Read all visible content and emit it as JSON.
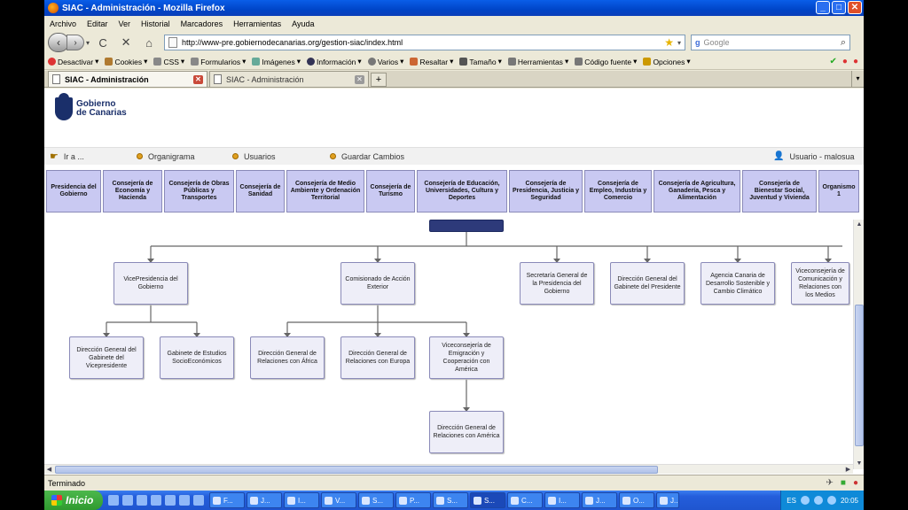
{
  "window": {
    "title": "SIAC - Administración - Mozilla Firefox",
    "minimize": "_",
    "maximize": "□",
    "close": "✕"
  },
  "menu": [
    "Archivo",
    "Editar",
    "Ver",
    "Historial",
    "Marcadores",
    "Herramientas",
    "Ayuda"
  ],
  "nav": {
    "url": "http://www-pre.gobiernodecanarias.org/gestion-siac/index.html",
    "search_placeholder": "Google",
    "back_icon": "‹",
    "forward_icon": "›",
    "reload_icon": "C",
    "stop_icon": "✕",
    "home_icon": "⌂"
  },
  "devbar": [
    "Desactivar",
    "Cookies",
    "CSS",
    "Formularios",
    "Imágenes",
    "Información",
    "Varios",
    "Resaltar",
    "Tamaño",
    "Herramientas",
    "Código fuente",
    "Opciones"
  ],
  "tabs": [
    {
      "label": "SIAC - Administración",
      "active": true
    },
    {
      "label": "SIAC - Administración",
      "active": false
    }
  ],
  "logo": {
    "line1": "Gobierno",
    "line2": "de Canarias"
  },
  "actions": {
    "ira": "Ir a ...",
    "organigrama": "Organigrama",
    "usuarios": "Usuarios",
    "guardar": "Guardar Cambios",
    "usuario": "Usuario - malosua"
  },
  "departments": [
    "Presidencia del Gobierno",
    "Consejería de Economía y Hacienda",
    "Consejería de Obras Públicas y Transportes",
    "Consejería de Sanidad",
    "Consejería de Medio Ambiente y Ordenación Territorial",
    "Consejería de Turismo",
    "Consejería de Educación, Universidades, Cultura y Deportes",
    "Consejería de Presidencia, Justicia y Seguridad",
    "Consejería de Empleo, Industria y Comercio",
    "Consejería de Agricultura, Ganadería, Pesca y Alimentación",
    "Consejería de Bienestar Social, Juventud y Vivienda",
    "Organismo 1"
  ],
  "orgchart": {
    "level1": [
      "VicePresidencia del Gobierno",
      "Comisionado de Acción Exterior",
      "Secretaría General de la Presidencia del Gobierno",
      "Dirección General del Gabinete del Presidente",
      "Agencia Canaria de Desarrollo Sostenible y Cambio Climático",
      "Viceconsejería de Comunicación y Relaciones con los Medios"
    ],
    "level2_vice": [
      "Dirección General del Gabinete del Vicepresidente",
      "Gabinete de Estudios SocioEconómicos"
    ],
    "level2_accion": [
      "Dirección General de Relaciones con África",
      "Dirección General de Relaciones con Europa",
      "Viceconsejería de Emigración y Cooperación con América"
    ],
    "level3": [
      "Dirección General de Relaciones con América"
    ]
  },
  "status": {
    "text": "Terminado"
  },
  "taskbar": {
    "start": "Inicio",
    "items": [
      "F...",
      "J...",
      "I...",
      "V...",
      "S...",
      "P...",
      "S...",
      "S...",
      "C...",
      "I...",
      "J...",
      "O...",
      "J..."
    ],
    "lang": "ES",
    "clock": "20:05"
  }
}
